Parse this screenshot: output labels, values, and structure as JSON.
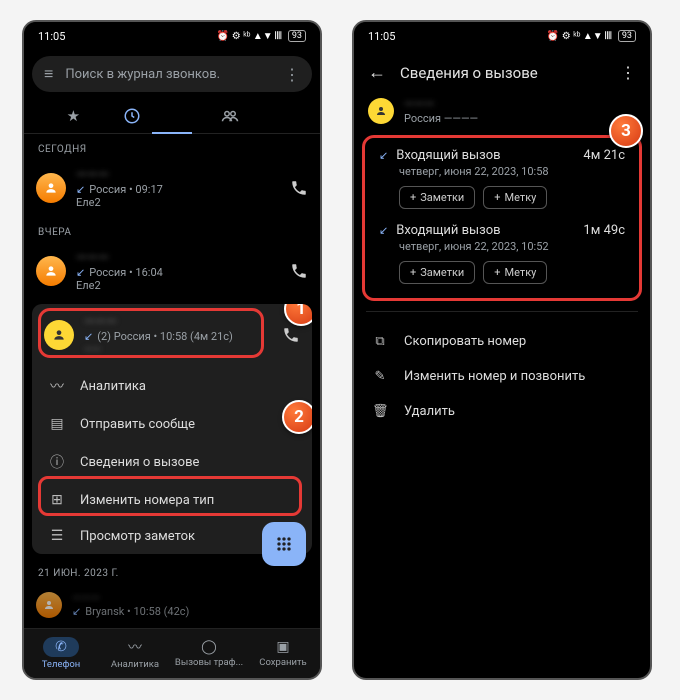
{
  "status": {
    "time": "11:05",
    "icons": "⏰ ⚙ ↕ 📶 ⋮[]",
    "battery": "93"
  },
  "left": {
    "search_placeholder": "Поиск в журнал звонков.",
    "tabs": {
      "star": "★",
      "recent": "◷",
      "contacts": "⌬"
    },
    "sec_today": "СЕГОДНЯ",
    "r1": {
      "name": "———",
      "sub_pre": "↙",
      "sub": "Россия  •  09:17",
      "carrier": "Еле2"
    },
    "sec_yesterday": "ВЧЕРА",
    "r2": {
      "name": "———",
      "sub_pre": "↙",
      "sub": "Россия  •  16:04",
      "carrier": "Еле2"
    },
    "card": {
      "name": "———",
      "sub": "(2) Россия  •  10:58  (4м 21с)",
      "sub2": "——"
    },
    "menu": {
      "analytics": "Аналитика",
      "send": "Отправить сообще",
      "details": "Сведения о вызове",
      "edit": "Изменить номера тип",
      "notes": "Просмотр заметок"
    },
    "sec_older": "21 ИЮН. 2023 Г.",
    "r4": {
      "name": "———",
      "sub": "Bryansk  •  10:58  (42с)"
    },
    "nav": {
      "phone": "Телефон",
      "analytics": "Аналитика",
      "calls": "Вызовы траф...",
      "save": "Сохранить"
    }
  },
  "right": {
    "title": "Сведения о вызове",
    "contact": {
      "name": "———",
      "sub": "Россия  ————"
    },
    "e1": {
      "type": "Входящий вызов",
      "dur": "4м 21с",
      "date": "четверг, июня 22, 2023, 10:58"
    },
    "e2": {
      "type": "Входящий вызов",
      "dur": "1м 49с",
      "date": "четверг, июня 22, 2023, 10:52"
    },
    "chips": {
      "notes": "Заметки",
      "tag": "Метку"
    },
    "actions": {
      "copy": "Скопировать номер",
      "edit": "Изменить номер и позвонить",
      "delete": "Удалить"
    }
  },
  "badges": {
    "b1": "1",
    "b2": "2",
    "b3": "3"
  }
}
